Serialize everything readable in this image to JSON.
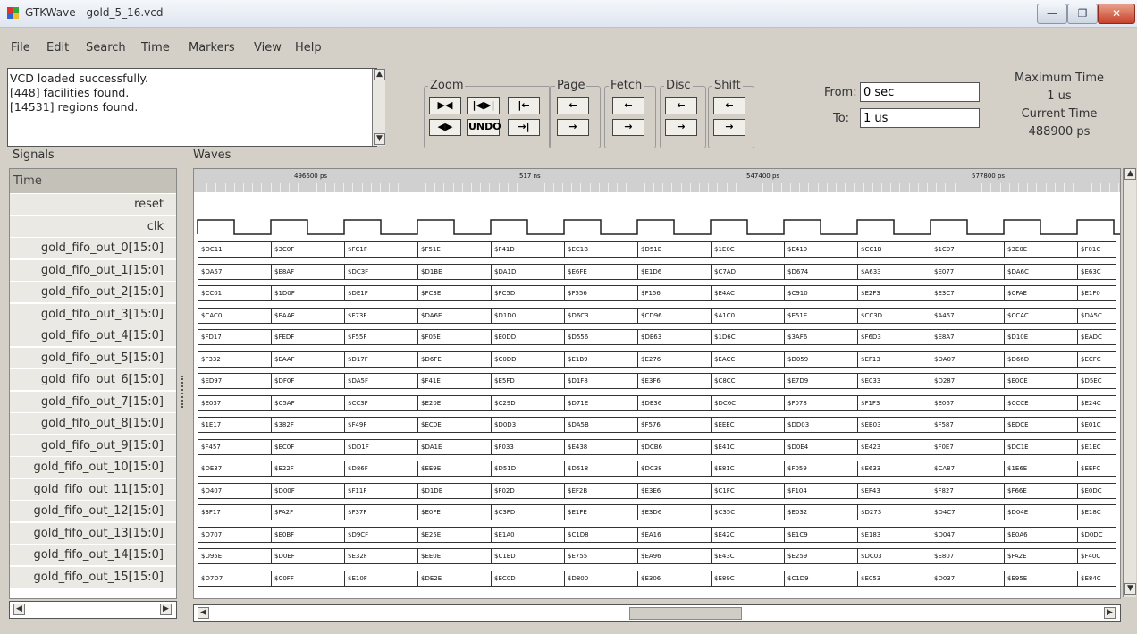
{
  "window": {
    "title": "GTKWave - gold_5_16.vcd",
    "controls": {
      "minimize": "—",
      "maximize": "❐",
      "close": "✕"
    }
  },
  "menu": [
    "File",
    "Edit",
    "Search",
    "Time",
    "Markers",
    "View",
    "Help"
  ],
  "log": [
    "VCD loaded successfully.",
    "[448] facilities found.",
    "[14531] regions found."
  ],
  "toolbar": {
    "zoom_label": "Zoom",
    "page_label": "Page",
    "fetch_label": "Fetch",
    "disc_label": "Disc",
    "shift_label": "Shift",
    "undo_label": "UNDO",
    "icons": {
      "zoom_fit": "zoom-fit-icon",
      "zoom_in": "zoom-in-icon",
      "zoom_out": "zoom-out-icon",
      "zoom_full": "zoom-full-icon",
      "zoom_end": "zoom-end-icon",
      "left": "arrow-left-icon",
      "right": "arrow-right-icon"
    }
  },
  "from_to": {
    "from_label": "From:",
    "from_value": "0 sec",
    "to_label": "To:",
    "to_value": "1 us"
  },
  "timeinfo": {
    "max_label": "Maximum Time",
    "max_value": "1 us",
    "cur_label": "Current Time",
    "cur_value": "488900 ps"
  },
  "panes": {
    "signals_label": "Signals",
    "waves_label": "Waves",
    "time_header": "Time"
  },
  "signals": [
    "reset",
    "clk",
    "gold_fifo_out_0[15:0]",
    "gold_fifo_out_1[15:0]",
    "gold_fifo_out_2[15:0]",
    "gold_fifo_out_3[15:0]",
    "gold_fifo_out_4[15:0]",
    "gold_fifo_out_5[15:0]",
    "gold_fifo_out_6[15:0]",
    "gold_fifo_out_7[15:0]",
    "gold_fifo_out_8[15:0]",
    "gold_fifo_out_9[15:0]",
    "gold_fifo_out_10[15:0]",
    "gold_fifo_out_11[15:0]",
    "gold_fifo_out_12[15:0]",
    "gold_fifo_out_13[15:0]",
    "gold_fifo_out_14[15:0]",
    "gold_fifo_out_15[15:0]"
  ],
  "ruler_labels": [
    "496600 ps",
    "517 ns",
    "547400 ps",
    "577800 ps"
  ],
  "bus_values": [
    [
      "$DC11",
      "$3C0F",
      "$FC1F",
      "$F51E",
      "$F41D",
      "$EC1B",
      "$D51B",
      "$1E0C",
      "$E419",
      "$CC1B",
      "$1C07",
      "$3E0E",
      "$F01C"
    ],
    [
      "$DA57",
      "$E8AF",
      "$DC3F",
      "$D1BE",
      "$DA1D",
      "$E6FE",
      "$E1D6",
      "$C7AD",
      "$D674",
      "$A633",
      "$E077",
      "$DA6C",
      "$E63C"
    ],
    [
      "$CC01",
      "$1D0F",
      "$DE1F",
      "$FC3E",
      "$FC5D",
      "$F556",
      "$F156",
      "$E4AC",
      "$C910",
      "$E2F3",
      "$E3C7",
      "$CFAE",
      "$E1F0"
    ],
    [
      "$CAC0",
      "$EAAF",
      "$F73F",
      "$DA6E",
      "$D1D0",
      "$D6C3",
      "$CD96",
      "$A1C0",
      "$E51E",
      "$CC3D",
      "$A457",
      "$CCAC",
      "$DA5C"
    ],
    [
      "$FD17",
      "$FEDF",
      "$F55F",
      "$F05E",
      "$E0DD",
      "$D556",
      "$DE63",
      "$1D6C",
      "$3AF6",
      "$F6D3",
      "$E8A7",
      "$D10E",
      "$EADC"
    ],
    [
      "$F332",
      "$EAAF",
      "$D17F",
      "$D6FE",
      "$C0DD",
      "$E1B9",
      "$E276",
      "$EACC",
      "$D059",
      "$EF13",
      "$DA07",
      "$D66D",
      "$ECFC"
    ],
    [
      "$ED97",
      "$DF0F",
      "$DA5F",
      "$F41E",
      "$E5FD",
      "$D1F8",
      "$E3F6",
      "$C8CC",
      "$E7D9",
      "$E033",
      "$D287",
      "$E0CE",
      "$D5EC"
    ],
    [
      "$E037",
      "$C5AF",
      "$CC3F",
      "$E20E",
      "$C29D",
      "$D71E",
      "$DE36",
      "$DC6C",
      "$F078",
      "$F1F3",
      "$E067",
      "$CCCE",
      "$E24C"
    ],
    [
      "$1E17",
      "$382F",
      "$F49F",
      "$EC0E",
      "$D0D3",
      "$DA5B",
      "$F576",
      "$EEEC",
      "$DD03",
      "$EB03",
      "$F587",
      "$EDCE",
      "$E01C"
    ],
    [
      "$F457",
      "$EC0F",
      "$DD1F",
      "$DA1E",
      "$F033",
      "$E438",
      "$DCB6",
      "$E41C",
      "$D0E4",
      "$E423",
      "$F0E7",
      "$DC1E",
      "$E1EC"
    ],
    [
      "$DE37",
      "$E22F",
      "$D86F",
      "$EE9E",
      "$D51D",
      "$D518",
      "$DC38",
      "$E81C",
      "$F059",
      "$E633",
      "$CA87",
      "$1E6E",
      "$EEFC"
    ],
    [
      "$D407",
      "$D00F",
      "$F11F",
      "$D1DE",
      "$F02D",
      "$EF2B",
      "$E3E6",
      "$C1FC",
      "$F104",
      "$EF43",
      "$F827",
      "$F66E",
      "$E0DC"
    ],
    [
      "$3F17",
      "$FA2F",
      "$F37F",
      "$E0FE",
      "$C3FD",
      "$E1FE",
      "$E3D6",
      "$C35C",
      "$E032",
      "$D273",
      "$D4C7",
      "$D04E",
      "$E18C"
    ],
    [
      "$D707",
      "$E0BF",
      "$D9CF",
      "$E25E",
      "$E1A0",
      "$C1D8",
      "$EA16",
      "$E42C",
      "$E1C9",
      "$E183",
      "$D047",
      "$E0A6",
      "$D0DC"
    ],
    [
      "$D95E",
      "$D0EF",
      "$E32F",
      "$EE0E",
      "$C1ED",
      "$E755",
      "$EA96",
      "$E43C",
      "$E259",
      "$DC03",
      "$E807",
      "$FA2E",
      "$F40C"
    ],
    [
      "$D7D7",
      "$C0FF",
      "$E10F",
      "$DE2E",
      "$EC0D",
      "$D800",
      "$E306",
      "$E89C",
      "$C1D9",
      "$E053",
      "$D037",
      "$E95E",
      "$E84C"
    ]
  ]
}
